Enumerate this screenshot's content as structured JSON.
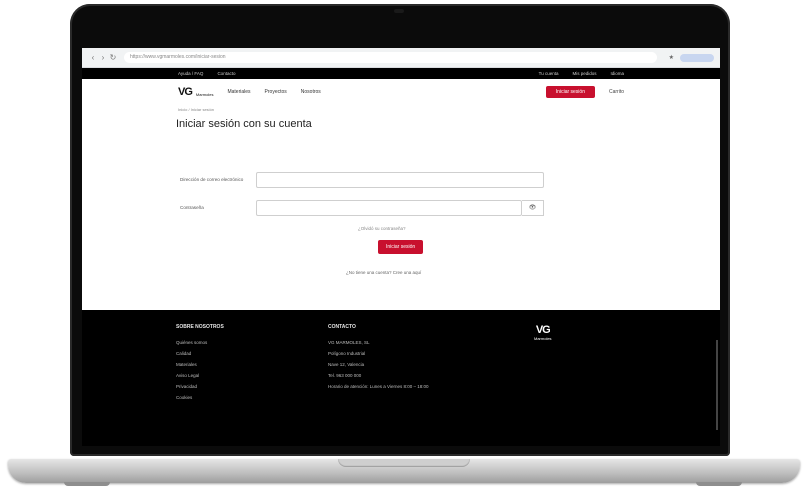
{
  "browser": {
    "url": "https://www.vgmarmoles.com/iniciar-sesion",
    "back": "‹",
    "forward": "›",
    "reload": "↻",
    "ext_icon": "★"
  },
  "site": {
    "topbar_left": [
      "Ayuda / FAQ",
      "Contacto"
    ],
    "topbar_right": [
      "Tu cuenta",
      "Mis pedidos",
      "Idioma"
    ],
    "logo": "VG",
    "logo_sub": "Marmoles",
    "menu": [
      "Materiales",
      "Proyectos",
      "Nosotros"
    ],
    "login_button": "Iniciar sesión",
    "cart": "Carrito",
    "breadcrumb": "Inicio  /  Iniciar sesión",
    "page_title": "Iniciar sesión con su cuenta"
  },
  "form": {
    "email_label": "Dirección de correo electrónico",
    "email_value": "",
    "password_label": "Contraseña",
    "password_value": "",
    "show_password": "👁",
    "forgot": "¿Olvidó su contraseña?",
    "submit": "Iniciar sesión",
    "no_account": "¿No tiene una cuenta? Cree una aquí"
  },
  "footer": {
    "col1_title": "SOBRE NOSOTROS",
    "col1_items": [
      "Quiénes somos",
      "Calidad",
      "Materiales",
      "Aviso Legal",
      "Privacidad",
      "Cookies"
    ],
    "col2_title": "CONTACTO",
    "col2_company": "VG MARMOLES, SL",
    "col2_address1": "Polígono Industrial",
    "col2_address2": "Nave 12, Valencia",
    "col2_phone": "Tel. 963 000 000",
    "col2_hours": "Horario de atención: Lunes a Viernes 8:00 – 18:00",
    "logo": "VG",
    "logo_sub": "Marmoles"
  }
}
